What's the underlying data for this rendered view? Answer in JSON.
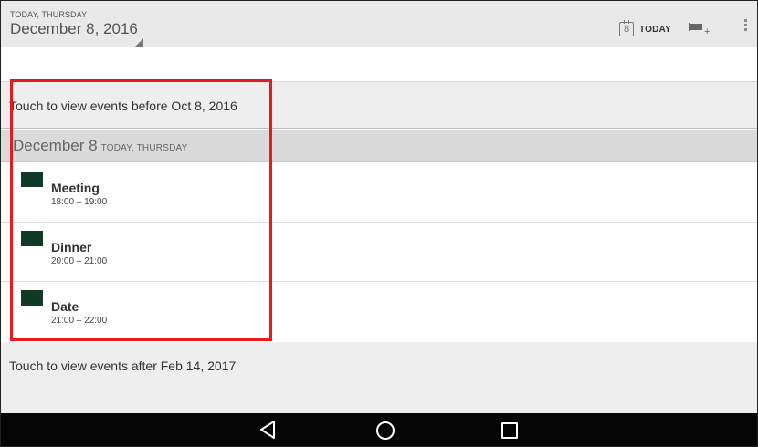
{
  "action_bar": {
    "date_small": "TODAY, THURSDAY",
    "date_big": "December 8, 2016",
    "today_icon_day": "8",
    "today_label": "TODAY",
    "icons": [
      "calendar-today-icon",
      "new-event-icon",
      "overflow-menu-icon"
    ]
  },
  "agenda": {
    "load_before": "Touch to view events before Oct 8, 2016",
    "day_header": {
      "date": "December 8",
      "sub": "TODAY, THURSDAY"
    },
    "events": [
      {
        "title": "Meeting",
        "time": "18:00 – 19:00",
        "color": "#103a26"
      },
      {
        "title": "Dinner",
        "time": "20:00 – 21:00",
        "color": "#103a26"
      },
      {
        "title": "Date",
        "time": "21:00 – 22:00",
        "color": "#103a26"
      }
    ],
    "load_after": "Touch to view events after Feb 14, 2017"
  },
  "annotation": {
    "highlight_color": "#e8191f"
  },
  "nav_bar": {
    "icons": [
      "back-icon",
      "home-icon",
      "recents-icon"
    ]
  }
}
